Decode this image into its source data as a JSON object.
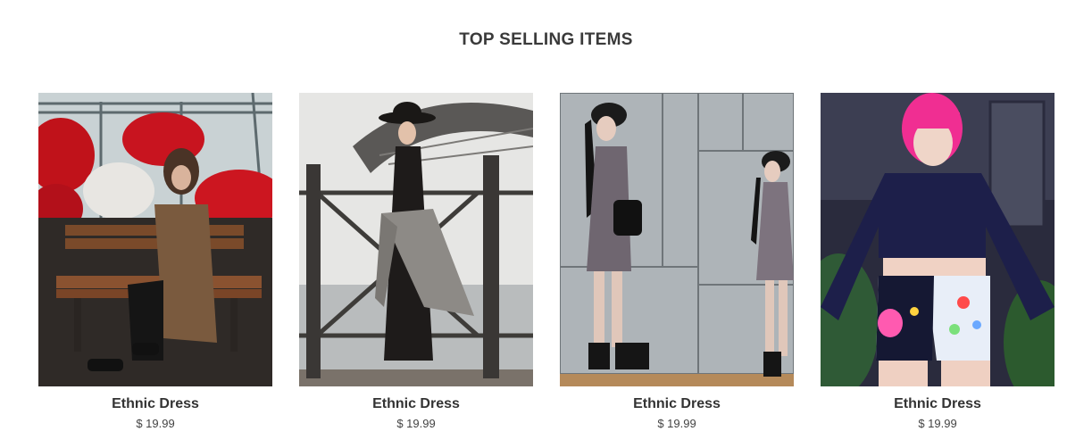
{
  "section": {
    "title": "TOP SELLING ITEMS"
  },
  "products": [
    {
      "name": "Ethnic Dress",
      "price": "$ 19.99",
      "image": "woman-in-brown-coat-on-bench-with-red-flowers"
    },
    {
      "name": "Ethnic Dress",
      "price": "$ 19.99",
      "image": "woman-in-black-dress-and-hat-by-bridge-railing"
    },
    {
      "name": "Ethnic Dress",
      "price": "$ 19.99",
      "image": "woman-in-grey-dress-against-marble-wall"
    },
    {
      "name": "Ethnic Dress",
      "price": "$ 19.99",
      "image": "woman-with-pink-hair-in-velvet-crop-top"
    }
  ]
}
